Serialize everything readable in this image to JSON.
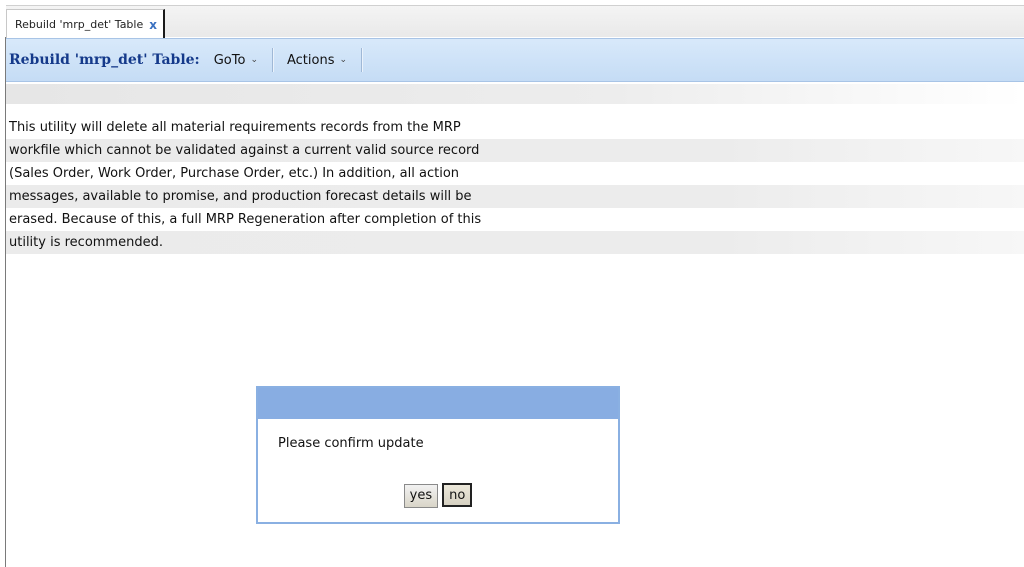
{
  "tab": {
    "label": "Rebuild 'mrp_det' Table",
    "close_glyph": "x"
  },
  "menubar": {
    "title": "Rebuild 'mrp_det' Table:",
    "goto_label": "GoTo",
    "actions_label": "Actions",
    "chevron_glyph": "⌄"
  },
  "description": {
    "lines": [
      "This utility will delete all material requirements records from the MRP",
      "workfile which cannot be validated against a current valid source record",
      "(Sales Order, Work Order, Purchase Order, etc.)  In addition, all action",
      "messages, available to promise, and production forecast details will be",
      "erased.  Because of this, a full MRP Regeneration after completion of this",
      "utility is recommended."
    ]
  },
  "dialog": {
    "message": "Please confirm update",
    "yes_label": "yes",
    "no_label": "no"
  },
  "colors": {
    "menu_title": "#14398a",
    "dialog_title_bar": "#88ade2",
    "menubar_bg": "#d2e4f8"
  }
}
